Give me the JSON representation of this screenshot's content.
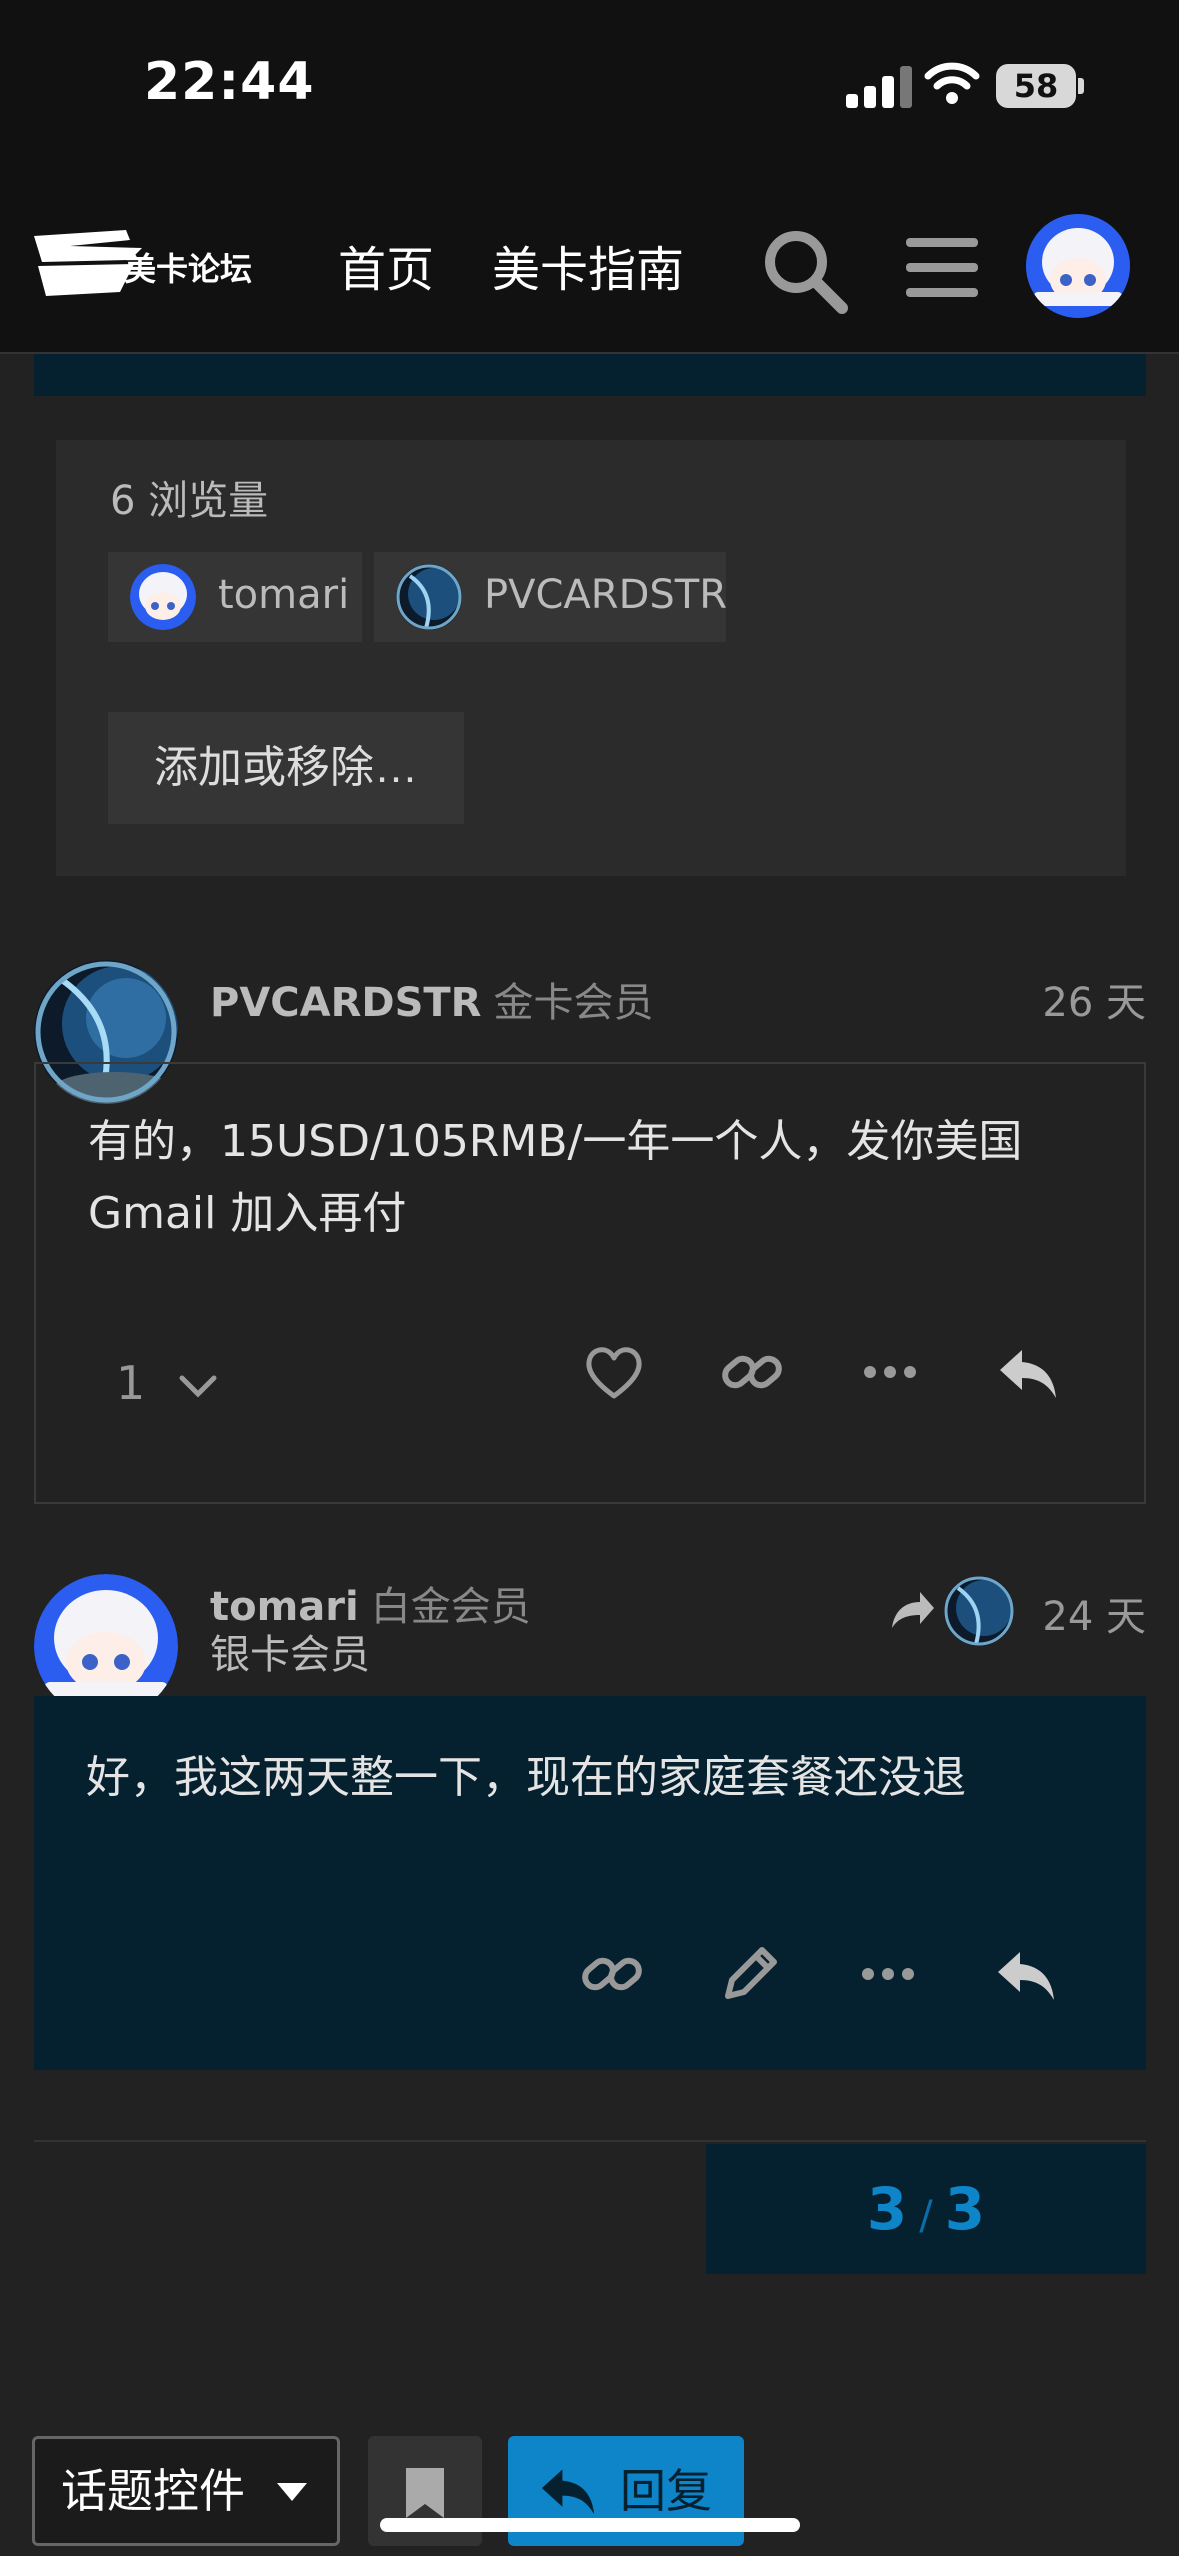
{
  "status_bar": {
    "time": "22:44",
    "battery": "58"
  },
  "header": {
    "logo_text": "美卡论坛",
    "nav": [
      "首页",
      "美卡指南"
    ]
  },
  "topic_info": {
    "views": "6 浏览量",
    "participants": [
      "tomari",
      "PVCARDSTR"
    ],
    "add_remove_label": "添加或移除…"
  },
  "posts": [
    {
      "username": "PVCARDSTR",
      "flair": "金卡会员",
      "age": "26 天",
      "text_lines": [
        "有的，15USD/105RMB/一年一个人，发你美国",
        "Gmail 加入再付"
      ],
      "like_count": "1"
    },
    {
      "username": "tomari",
      "flair": "白金会员",
      "title": "银卡会员",
      "age": "24 天",
      "text_lines": [
        "好，我这两天整一下，现在的家庭套餐还没退"
      ]
    }
  ],
  "progress": {
    "current": "3",
    "total": "3"
  },
  "footer": {
    "topic_controls_label": "话题控件",
    "reply_label": "回复"
  },
  "colors": {
    "accent": "#0d85c8",
    "highlight_bg": "#05202e",
    "background": "#222222",
    "header_bg": "#111111"
  }
}
